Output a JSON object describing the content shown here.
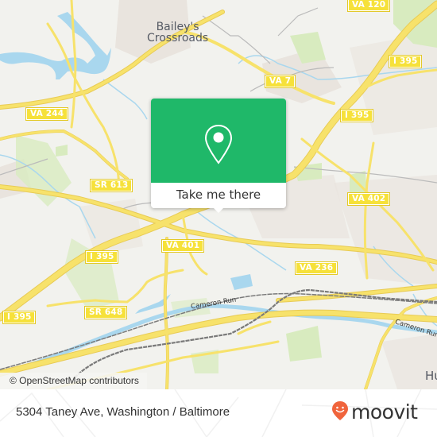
{
  "map": {
    "place_labels": [
      {
        "id": "baileys-crossroads",
        "text": "Bailey's\nCrossroads"
      }
    ],
    "route_shields": [
      {
        "id": "va-120",
        "text": "VA 120"
      },
      {
        "id": "va-7",
        "text": "VA 7"
      },
      {
        "id": "va-244",
        "text": "VA 244"
      },
      {
        "id": "i-395-ne",
        "text": "I 395"
      },
      {
        "id": "i-395-center",
        "text": "I 395"
      },
      {
        "id": "sr-613",
        "text": "SR 613"
      },
      {
        "id": "va-402",
        "text": "VA 402"
      },
      {
        "id": "va-401",
        "text": "VA 401"
      },
      {
        "id": "i-395-w",
        "text": "I 395"
      },
      {
        "id": "va-236",
        "text": "VA 236"
      },
      {
        "id": "i-395-sw",
        "text": "I 395"
      },
      {
        "id": "sr-648",
        "text": "SR 648"
      }
    ],
    "waterway_labels": [
      {
        "id": "cameron-run-west",
        "text": "Cameron Run"
      },
      {
        "id": "cameron-run-east",
        "text": "Cameron Run"
      }
    ],
    "partial_labels": [
      {
        "id": "huntington-partial",
        "text": "Hu"
      }
    ],
    "attribution": "© OpenStreetMap contributors",
    "colors": {
      "land": "#f2f2ee",
      "road": "#f7e26b",
      "water": "#a9d7ee",
      "park": "#d9ecc0",
      "urban": "#e8e2dc",
      "rail": "#777777"
    }
  },
  "popup": {
    "icon": "location-pin-icon",
    "button_label": "Take me there",
    "accent": "#1fb869"
  },
  "footer": {
    "address": "5304 Taney Ave, Washington / Baltimore",
    "logo_text": "moovit",
    "logo_color": "#f0643c"
  }
}
